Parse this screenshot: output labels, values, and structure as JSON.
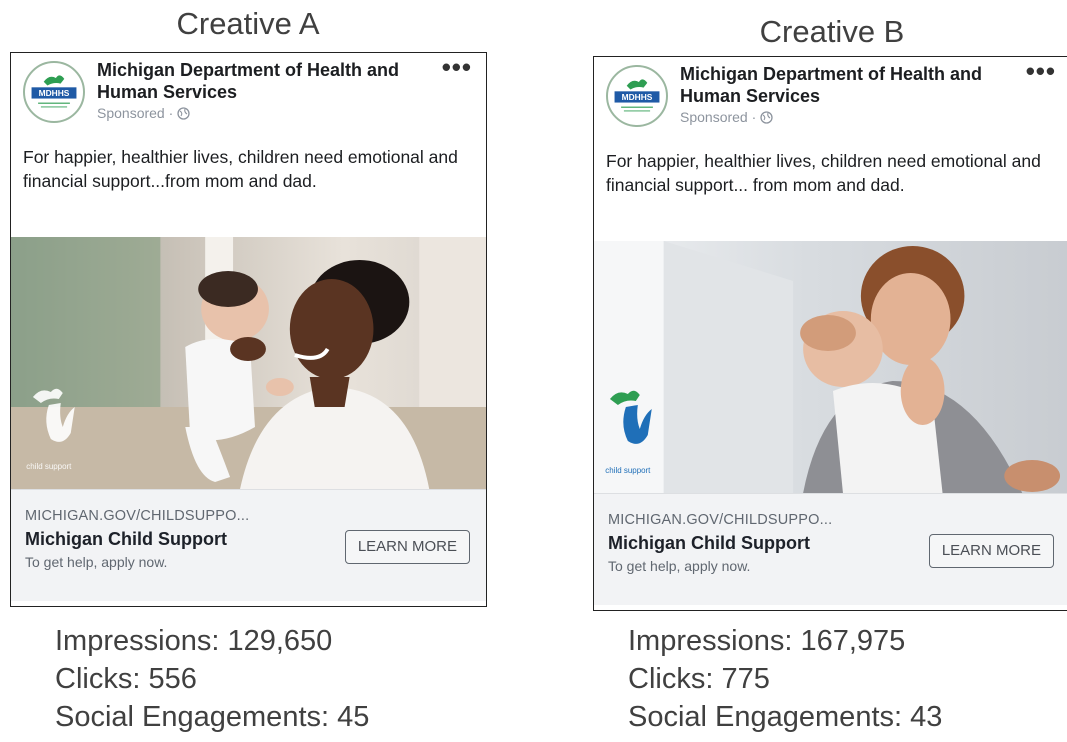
{
  "creatives": [
    {
      "title": "Creative A",
      "page_name": "Michigan Department of Health and Human Services",
      "logo_text": "MDHHS",
      "sponsored": "Sponsored ·",
      "more_icon": "more-horizontal-icon",
      "body": "For happier, healthier lives, children need emotional and financial support...from mom and dad.",
      "watermark_text": "child support",
      "link_url": "MICHIGAN.GOV/CHILDSUPPO...",
      "link_title": "Michigan Child Support",
      "link_desc": "To get help, apply now.",
      "cta": "LEARN MORE",
      "stats": {
        "impressions": "Impressions: 129,650",
        "clicks": "Clicks: 556",
        "engagements": "Social Engagements: 45"
      }
    },
    {
      "title": "Creative B",
      "page_name": "Michigan Department of Health and Human Services",
      "logo_text": "MDHHS",
      "sponsored": "Sponsored ·",
      "more_icon": "more-horizontal-icon",
      "body": "For happier, healthier lives, children need emotional and financial support... from mom and dad.",
      "watermark_text": "child support",
      "link_url": "MICHIGAN.GOV/CHILDSUPPO...",
      "link_title": "Michigan Child Support",
      "link_desc": "To get help, apply now.",
      "cta": "LEARN MORE",
      "stats": {
        "impressions": "Impressions: 167,975",
        "clicks": "Clicks: 775",
        "engagements": "Social Engagements: 43"
      }
    }
  ],
  "colors": {
    "logo_blue": "#1f5aa6",
    "logo_green": "#2e9e52",
    "footer_bg": "#f2f3f5"
  }
}
